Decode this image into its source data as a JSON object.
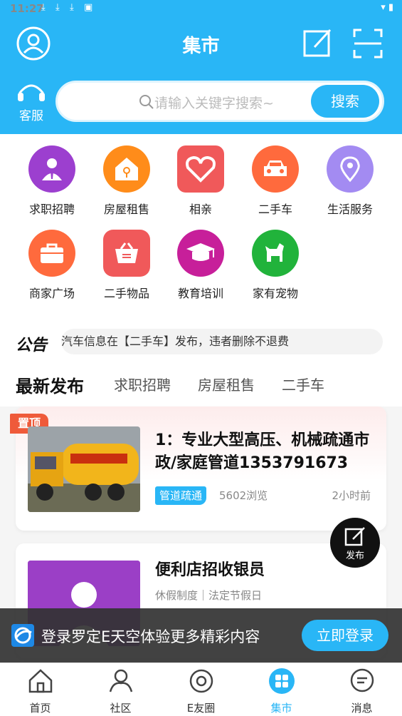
{
  "status_bar": {
    "time": "11:27"
  },
  "header": {
    "title": "集市"
  },
  "kefu": {
    "label": "客服"
  },
  "search": {
    "placeholder": "请输入关键字搜索~",
    "button": "搜索"
  },
  "categories": [
    {
      "label": "求职招聘",
      "icon": "job-icon",
      "color": "#9c3fcf"
    },
    {
      "label": "房屋租售",
      "icon": "house-icon",
      "color": "#ff8c1a"
    },
    {
      "label": "相亲",
      "icon": "heart-icon",
      "color": "#f0595a"
    },
    {
      "label": "二手车",
      "icon": "car-icon",
      "color": "#ff6a3d"
    },
    {
      "label": "生活服务",
      "icon": "location-icon",
      "color": "#a38bf2"
    },
    {
      "label": "商家广场",
      "icon": "shop-icon",
      "color": "#ff6a3d"
    },
    {
      "label": "二手物品",
      "icon": "basket-icon",
      "color": "#f0595a"
    },
    {
      "label": "教育培训",
      "icon": "graduation-cap-icon",
      "color": "#c71f9a"
    },
    {
      "label": "家有宠物",
      "icon": "dog-icon",
      "color": "#21b33b"
    }
  ],
  "notice": {
    "logo": "公告",
    "text": "汽车信息在【二手车】发布，违者删除不退费"
  },
  "tabs": [
    "最新发布",
    "求职招聘",
    "房屋租售",
    "二手车"
  ],
  "posts": [
    {
      "pinned_label": "置顶",
      "title": "1：专业大型高压、机械疏通市政/家庭管道1353791673",
      "tag": "管道疏通",
      "views": "5602浏览",
      "time": "2小时前"
    },
    {
      "title": "便利店招收银员",
      "subline": "休假制度｜法定节假日"
    }
  ],
  "fab": {
    "label": "发布"
  },
  "login_banner": {
    "text": "登录罗定E天空体验更多精彩内容",
    "button": "立即登录"
  },
  "bottom_nav": [
    {
      "label": "首页",
      "icon": "home-icon"
    },
    {
      "label": "社区",
      "icon": "community-icon"
    },
    {
      "label": "E友圈",
      "icon": "planet-icon"
    },
    {
      "label": "集市",
      "icon": "market-icon",
      "active": true
    },
    {
      "label": "消息",
      "icon": "message-icon"
    }
  ],
  "colors": {
    "primary": "#29b6f6",
    "pin": "#ef5a3a"
  }
}
